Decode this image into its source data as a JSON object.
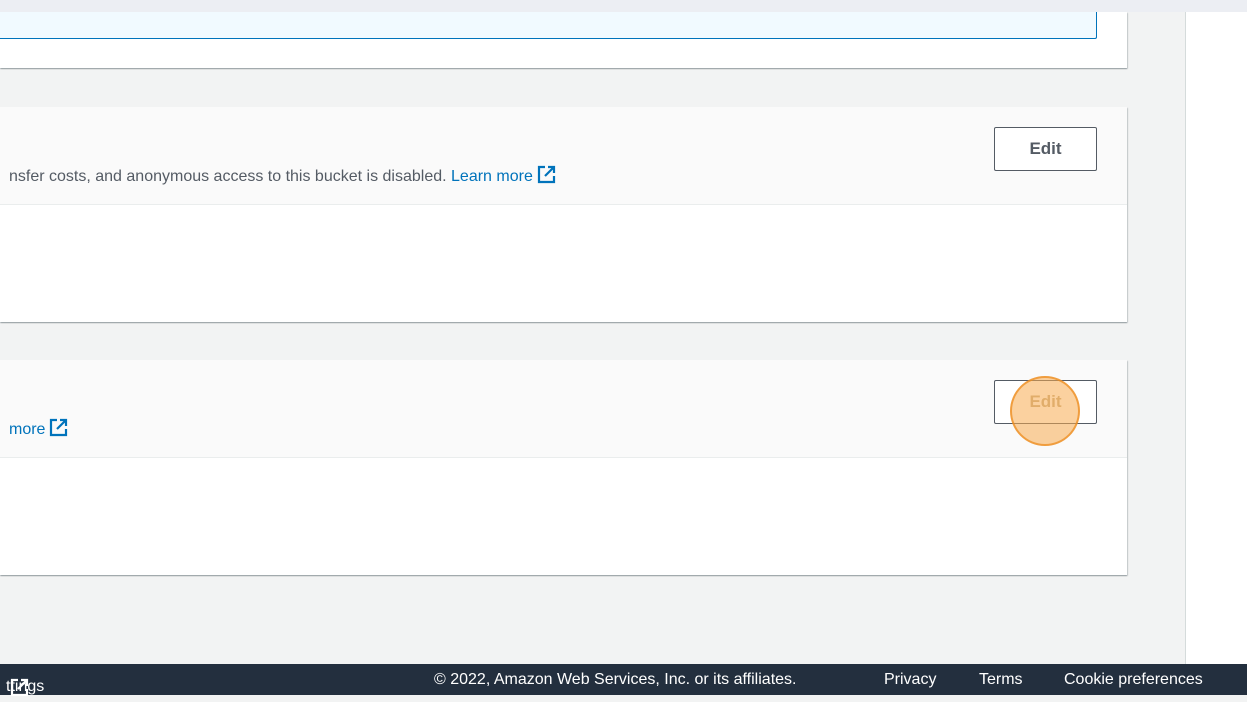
{
  "sections": [
    {
      "description_prefix": "nsfer costs, and anonymous access to this bucket is disabled.",
      "learn_more_label": "Learn more",
      "edit_label": "Edit"
    },
    {
      "description_prefix": "",
      "learn_more_label": "more",
      "edit_label": "Edit"
    }
  ],
  "footer": {
    "settings_label": "ttings",
    "copyright": "© 2022, Amazon Web Services, Inc. or its affiliates.",
    "privacy": "Privacy",
    "terms": "Terms",
    "cookie_preferences": "Cookie preferences"
  },
  "colors": {
    "link": "#0073bb",
    "footer_bg": "#232f3e",
    "click_marker": "#f7ac50"
  },
  "icons": {
    "external_link": "external-link-icon"
  }
}
